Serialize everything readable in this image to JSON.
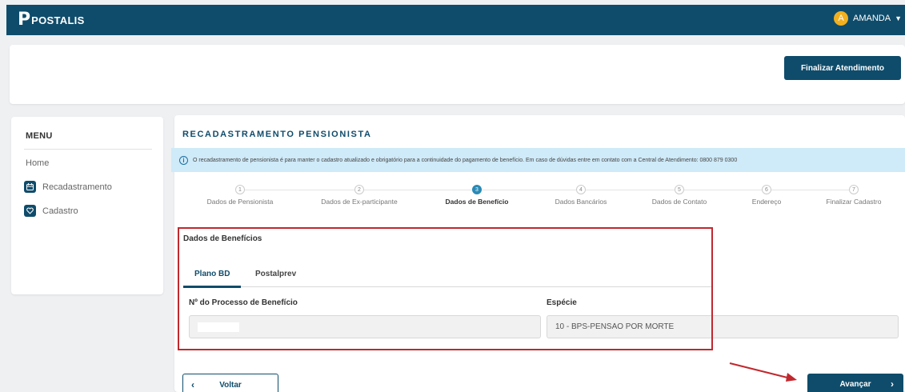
{
  "topbar": {
    "logo_mark": "P",
    "logo_text": "POSTALIS",
    "user_initial": "A",
    "user_name": "AMANDA",
    "caret": "▼"
  },
  "header": {
    "finalizar_label": "Finalizar Atendimento"
  },
  "menu": {
    "title": "MENU",
    "home": "Home",
    "items": [
      {
        "label": "Recadastramento",
        "icon": "calendar-icon"
      },
      {
        "label": "Cadastro",
        "icon": "heart-icon"
      }
    ]
  },
  "main": {
    "title": "RECADASTRAMENTO PENSIONISTA",
    "info_icon": "i",
    "info_text": "O recadastramento de pensionista é para manter o cadastro atualizado e obrigatório para a continuidade do pagamento de benefício. Em caso de dúvidas entre em contato com a Central de Atendimento: 0800 879 0300",
    "steps": [
      {
        "num": "1",
        "label": "Dados de Pensionista"
      },
      {
        "num": "2",
        "label": "Dados de Ex-participante"
      },
      {
        "num": "3",
        "label": "Dados de Benefício"
      },
      {
        "num": "4",
        "label": "Dados Bancários"
      },
      {
        "num": "5",
        "label": "Dados de Contato"
      },
      {
        "num": "6",
        "label": "Endereço"
      },
      {
        "num": "7",
        "label": "Finalizar Cadastro"
      }
    ],
    "active_step": 3,
    "section_title": "Dados de Benefícios",
    "tabs": [
      {
        "label": "Plano BD"
      },
      {
        "label": "Postalprev"
      }
    ],
    "fields": {
      "processo_label": "Nº do Processo de Benefício",
      "processo_value": "",
      "especie_label": "Espécie",
      "especie_value": "10 - BPS-PENSAO POR MORTE"
    }
  },
  "footer": {
    "voltar_label": "Voltar",
    "avancar_label": "Avançar",
    "chev_left": "‹",
    "chev_right": "›"
  },
  "colors": {
    "primary": "#0f4c6b",
    "accent": "#2a8ab5",
    "banner": "#cfeaf8",
    "highlight": "#c0282e",
    "avatar": "#f2b01e"
  }
}
